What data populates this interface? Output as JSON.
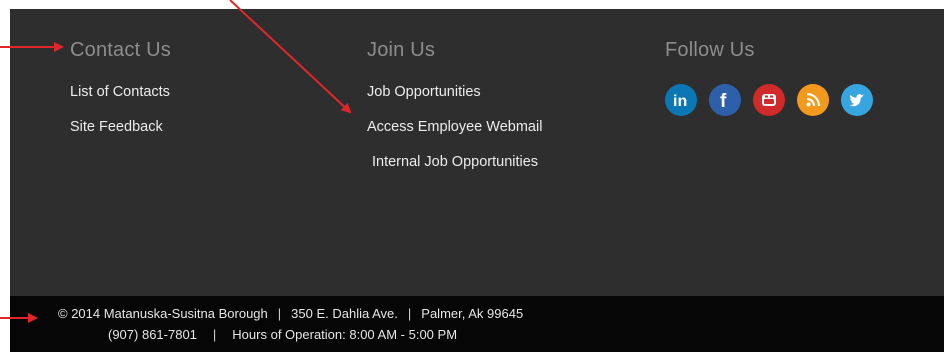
{
  "contact": {
    "heading": "Contact Us",
    "links": [
      "List of Contacts",
      "Site Feedback"
    ]
  },
  "join": {
    "heading": "Join Us",
    "links": [
      "Job Opportunities",
      "Access Employee Webmail",
      "Internal Job Opportunities"
    ]
  },
  "follow": {
    "heading": "Follow Us",
    "icons": [
      {
        "name": "linkedin-icon",
        "color": "#0b78b5"
      },
      {
        "name": "facebook-icon",
        "color": "#2d5faa"
      },
      {
        "name": "youtube-icon",
        "color": "#d12a2a"
      },
      {
        "name": "rss-icon",
        "color": "#f39a1c"
      },
      {
        "name": "twitter-icon",
        "color": "#36a5e0"
      }
    ]
  },
  "footer": {
    "copyright": "© 2014 Matanuska-Susitna Borough",
    "address": "350 E. Dahlia Ave.",
    "city": "Palmer, Ak 99645",
    "phone": "(907) 861-7801",
    "hours": "Hours of Operation: 8:00 AM - 5:00 PM",
    "separator": "|"
  },
  "colors": {
    "panel": "#2e2e2e",
    "bottom_bar": "#060606",
    "heading": "#8d8d8d",
    "link": "#ececec",
    "annotation_arrow": "#e0262b"
  }
}
